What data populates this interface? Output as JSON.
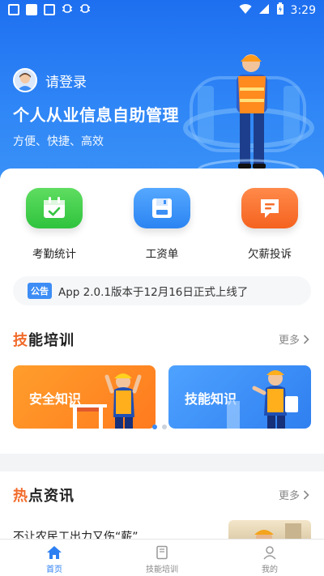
{
  "status_bar": {
    "time": "3:29"
  },
  "hero": {
    "login_label": "请登录",
    "title": "个人从业信息自助管理",
    "subtitle": "方便、快捷、高效"
  },
  "quick_actions": [
    {
      "label": "考勤统计",
      "icon": "calendar-check-icon",
      "color": "#35c742"
    },
    {
      "label": "工资单",
      "icon": "floppy-disk-icon",
      "color": "#3b8ff5"
    },
    {
      "label": "欠薪投诉",
      "icon": "message-report-icon",
      "color": "#f66e2a"
    }
  ],
  "notice": {
    "tag": "公告",
    "text": "App 2.0.1版本于12月16日正式上线了"
  },
  "training": {
    "title_accent": "技",
    "title_rest": "能培训",
    "more": "更多",
    "cards": [
      {
        "label": "安全知识",
        "color": "#ff8a25"
      },
      {
        "label": "技能知识",
        "color": "#3d8df5"
      }
    ],
    "carousel_active_index": 0
  },
  "news": {
    "title_accent": "热",
    "title_rest": "点资讯",
    "more": "更多",
    "items": [
      {
        "title": "不让农民工出力又伤“薪”"
      }
    ]
  },
  "tabbar": {
    "items": [
      {
        "label": "首页",
        "icon": "home-icon",
        "active": true
      },
      {
        "label": "技能培训",
        "icon": "book-icon",
        "active": false
      },
      {
        "label": "我的",
        "icon": "user-icon",
        "active": false
      }
    ]
  }
}
